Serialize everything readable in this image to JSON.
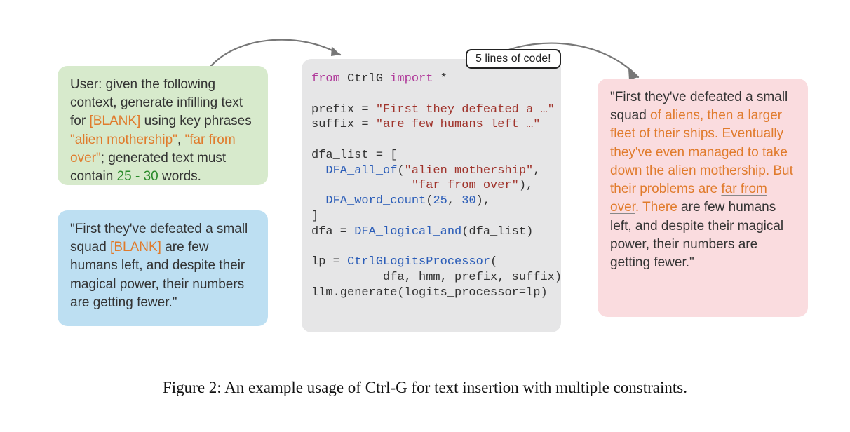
{
  "badge": {
    "code": "5 lines of code!"
  },
  "left_green": {
    "label_user": "User:",
    "t1": " given the following context, generate infilling text for ",
    "blank": "[BLANK]",
    "t2": " using key phrases ",
    "kp1": "\"alien mothership\"",
    "comma": ", ",
    "kp2": "\"far from over\"",
    "t3": "; generated text must contain ",
    "count": "25 - 30",
    "t4": " words."
  },
  "left_blue": {
    "q1": "\"First they've defeated a small squad ",
    "blank": "[BLANK]",
    "q2": " are few humans left, and despite their magical power, their numbers are getting fewer.\""
  },
  "code": {
    "l1_from": "from",
    "l1_mod": " CtrlG ",
    "l1_import": "import",
    "l1_star": " *",
    "l2a": "prefix = ",
    "l2q": "\"First they defeated a …\"",
    "l3a": "suffix = ",
    "l3q": "\"are few humans left …\"",
    "l4": "dfa_list = [",
    "l5fn": "  DFA_all_of",
    "l5p": "(",
    "l5s1": "\"alien mothership\"",
    "l5c": ",",
    "l6pad": "              ",
    "l6s2": "\"far from over\"",
    "l6p": "),",
    "l7fn": "  DFA_word_count",
    "l7p": "(",
    "l7n1": "25",
    "l7c": ", ",
    "l7n2": "30",
    "l7pp": "),",
    "l8": "]",
    "l9a": "dfa = ",
    "l9fn": "DFA_logical_and",
    "l9p": "(dfa_list)",
    "l11a": "lp = ",
    "l11fn": "CtrlGLogitsProcessor",
    "l11p": "(",
    "l12": "          dfa, hmm, prefix, suffix)",
    "l13a": "llm.generate(logits_processor=lp)"
  },
  "right_pink": {
    "p1": "\"First they've defeated a small squad ",
    "gen1": "of aliens, then a larger fleet of their ships. Eventually they've even managed to take down the ",
    "kp1": "alien mothership",
    "gen2": ". But their problems are ",
    "kp2": "far from over",
    "gen3": ". There",
    "p2": " are few humans left, and despite their magical power, their numbers are getting fewer.\""
  },
  "caption": "Figure 2: An example usage of Ctrl-G for text insertion with multiple constraints."
}
